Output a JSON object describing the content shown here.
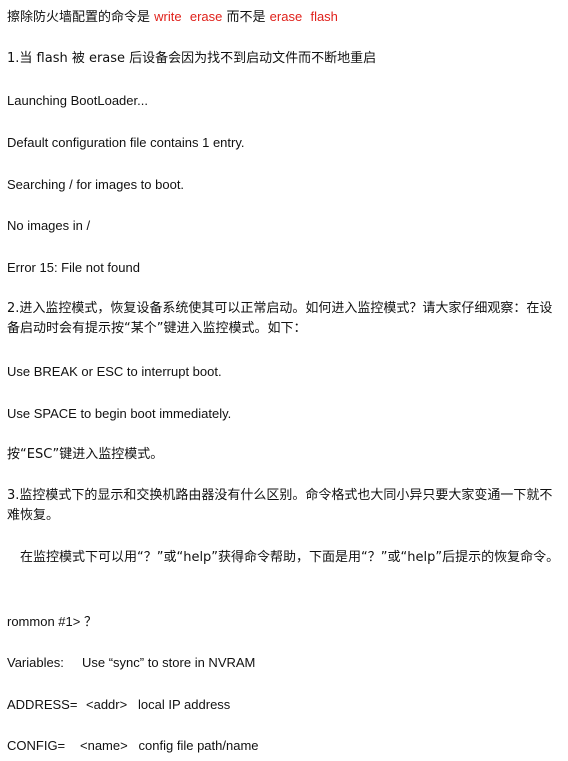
{
  "doc": {
    "title": {
      "prefix": "擦除防火墙配置的命令是 ",
      "cmd_write": "write",
      "cmd_erase1": "erase",
      "middle": " 而不是 ",
      "cmd_erase2": "erase",
      "cmd_flash": "flash"
    },
    "p1": "1.当 flash 被 erase 后设备会因为找不到启动文件而不断地重启",
    "log": [
      "Launching BootLoader...",
      "Default configuration file contains 1 entry.",
      "Searching / for images to boot.",
      "No images in /",
      "Error 15: File not found"
    ],
    "p2": " 2.进入监控模式，恢复设备系统使其可以正常启动。如何进入监控模式？请大家仔细观察：在设备启动时会有提示按“某个”键进入监控模式。如下：",
    "prompt_lines": [
      "Use BREAK or ESC to interrupt boot.",
      "Use SPACE to begin boot immediately."
    ],
    "p3": "按“ESC”键进入监控模式。",
    "p4": "3.监控模式下的显示和交换机路由器没有什么区别。命令格式也大同小异只要大家变通一下就不难恢复。",
    "p5": "　在监控模式下可以用“？”或“help”获得命令帮助，下面是用“？”或“help”后提示的恢复命令。",
    "rommon": "rommon #1>  ？",
    "help_rows": [
      {
        "key": "Variables:",
        "value": "Use “sync” to store in NVRAM"
      },
      {
        "key": "ADDRESS=",
        "value": "<addr>   local IP address"
      },
      {
        "key": "CONFIG=",
        "value": "<name>   config file path/name"
      }
    ],
    "colors": {
      "text": "#111111",
      "highlight": "#e0211b"
    }
  }
}
